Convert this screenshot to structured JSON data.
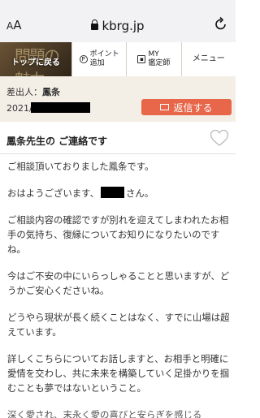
{
  "browser": {
    "aa_small": "A",
    "aa_big": "A",
    "url": "kbrg.jp"
  },
  "nav": {
    "top_logo_text": "問題の魅力",
    "top_label": "トップに戻る",
    "point_line1": "ポイント",
    "point_line2": "追加",
    "my_line1": "MY",
    "my_line2": "鑑定師",
    "menu_label": "メニュー"
  },
  "message": {
    "sender_label": "差出人：",
    "sender_name": "鳳条",
    "date_prefix": "2021/",
    "reply_label": "返信する",
    "subject": "鳳条先生の ご連絡です",
    "paragraphs": {
      "p1": "ご相談頂いておりました鳳条です。",
      "p2_before": "おはようございます、",
      "p2_after": "さん。",
      "p3": "ご相談内容の確認ですが別れを迎えてしまわれたお相手の気持ち、復縁についてお知りになりたいのですね。",
      "p4": "今はご不安の中にいらっしゃることと思いますが、どうかご安心くださいね。",
      "p5": "どうやら現状が長く続くことはなく、すでに山場は超えています。",
      "p6": "詳しくこちらについてお話しますと、お相手と明確に愛情を交わし、共に未来を構築していく足掛かりを掴むことも夢ではないということ。",
      "p7": "深く愛され、末永く愛の喜びと安らぎを感じる"
    }
  },
  "colors": {
    "reply_button": "#e8664a",
    "sender_bg": "#f4efe6"
  }
}
